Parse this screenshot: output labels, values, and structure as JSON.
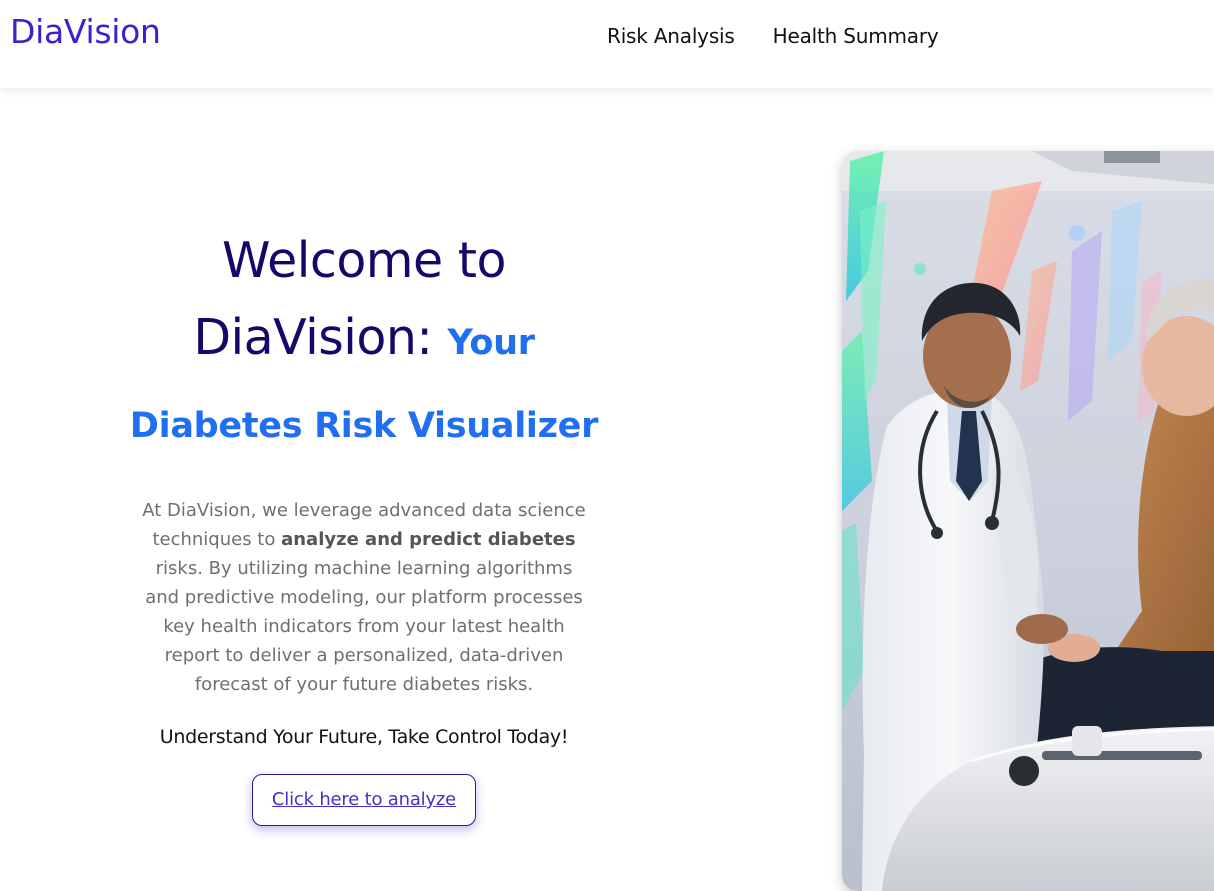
{
  "navbar": {
    "brand": "DiaVision",
    "links": [
      {
        "label": "Risk Analysis"
      },
      {
        "label": "Health Summary"
      }
    ]
  },
  "hero": {
    "title_part1": "Welcome to DiaVision: ",
    "title_part2": "Your Diabetes Risk Visualizer",
    "description": {
      "text1": "At DiaVision, we leverage advanced data science techniques to ",
      "bold1": "analyze and predict diabetes",
      "text2": " risks. By utilizing machine learning algorithms and predictive modeling, our platform processes key health indicators from your latest health report to deliver a personalized, data-driven forecast of your future diabetes risks."
    },
    "tagline": "Understand Your Future, Take Control Today!",
    "cta_label": "Click here to analyze"
  },
  "colors": {
    "brand": "#3f1fd0",
    "title": "#14096b",
    "accent": "#1f6ff0",
    "body_text": "#6f6f6f"
  }
}
